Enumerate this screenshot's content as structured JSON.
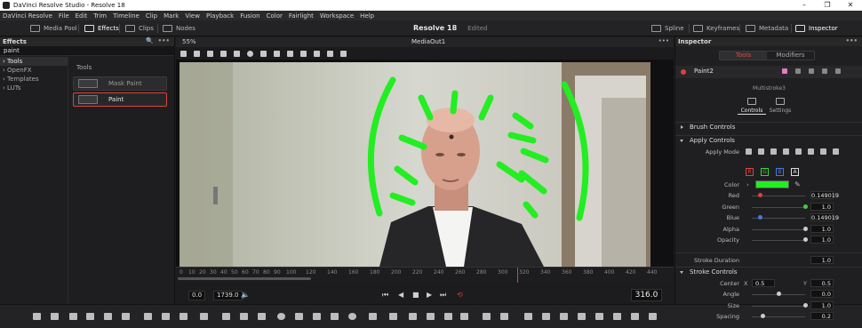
{
  "window": {
    "title": "DaVinci Resolve Studio - Resolve 18"
  },
  "menu": [
    "DaVinci Resolve",
    "File",
    "Edit",
    "Trim",
    "Timeline",
    "Clip",
    "Mark",
    "View",
    "Playback",
    "Fusion",
    "Color",
    "Fairlight",
    "Workspace",
    "Help"
  ],
  "toolbar": {
    "media_pool": "Media Pool",
    "effects": "Effects",
    "clips": "Clips",
    "nodes": "Nodes",
    "project_name": "Resolve 18",
    "project_status": "Edited",
    "spline": "Spline",
    "keyframes": "Keyframes",
    "metadata": "Metadata",
    "inspector": "Inspector"
  },
  "effects_panel": {
    "title": "Effects",
    "search_value": "paint",
    "tree": [
      "Tools",
      "OpenFX",
      "Templates",
      "LUTs"
    ],
    "section_label": "Tools",
    "items": [
      "Mask Paint",
      "Paint"
    ]
  },
  "viewer": {
    "zoom": "55%",
    "name": "MediaOut1",
    "ruler_ticks": [
      "0",
      "10",
      "20",
      "30",
      "40",
      "50",
      "60",
      "70",
      "80",
      "90",
      "100",
      "120",
      "140",
      "160",
      "180",
      "200",
      "220",
      "240",
      "260",
      "280",
      "300",
      "320",
      "340",
      "360",
      "380",
      "400",
      "420",
      "440"
    ],
    "timecode_in": "0.0",
    "timecode_out": "1739.0",
    "current_frame": "316.0"
  },
  "inspector": {
    "title": "Inspector",
    "tabs": [
      "Tools",
      "Modifiers"
    ],
    "node_name": "Paint2",
    "node_type": "Multistroke3",
    "sub_tabs": [
      "Controls",
      "Settings"
    ],
    "sections": {
      "brush_controls": "Brush Controls",
      "apply_controls": "Apply Controls",
      "stroke_controls": "Stroke Controls"
    },
    "apply_mode_label": "Apply Mode",
    "channels": [
      "R",
      "G",
      "B",
      "A"
    ],
    "color_label": "Color",
    "color_swatch": "#22ee22",
    "params": [
      {
        "label": "Red",
        "value": "0.149019",
        "fill": 0.149,
        "knob": "#d9453a"
      },
      {
        "label": "Green",
        "value": "1.0",
        "fill": 1.0,
        "knob": "#3fcf3f"
      },
      {
        "label": "Blue",
        "value": "0.149019",
        "fill": 0.149,
        "knob": "#4a78d8"
      },
      {
        "label": "Alpha",
        "value": "1.0",
        "fill": 1.0,
        "knob": "#cccccc"
      },
      {
        "label": "Opacity",
        "value": "1.0",
        "fill": 1.0,
        "knob": "#cccccc"
      }
    ],
    "stroke_duration": {
      "label": "Stroke Duration",
      "value": "1.0"
    },
    "center": {
      "label": "Center",
      "x_label": "X",
      "x": "0.5",
      "y_label": "Y",
      "y": "0.5"
    },
    "stroke_params": [
      {
        "label": "Angle",
        "value": "0.0",
        "fill": 0.5
      },
      {
        "label": "Size",
        "value": "1.0",
        "fill": 1.0
      },
      {
        "label": "Spacing",
        "value": "0.2",
        "fill": 0.2
      }
    ]
  },
  "colors": {
    "accent": "#d9453a",
    "stroke_green": "#22ee22"
  }
}
